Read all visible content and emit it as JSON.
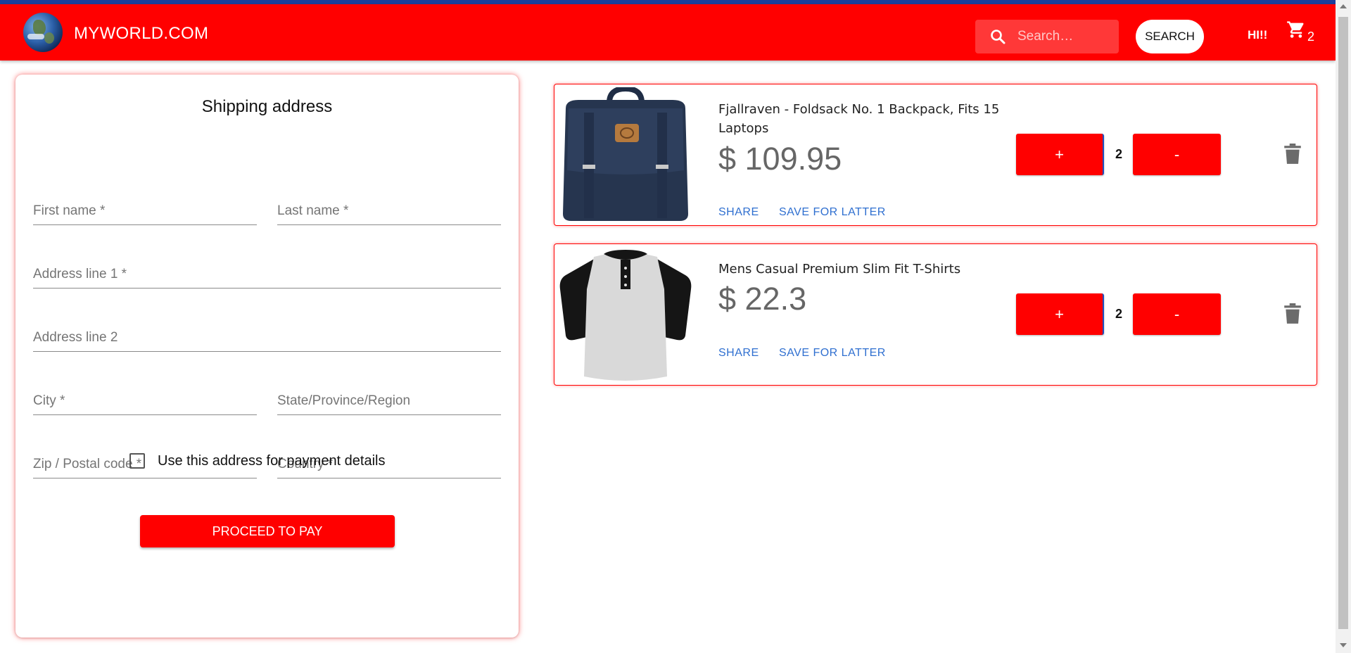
{
  "header": {
    "brand": "MYWORLD.COM",
    "logo_icon": "globe-icon",
    "search_placeholder": "Search…",
    "search_button": "SEARCH",
    "greeting": "HI!!",
    "cart_icon": "cart-icon",
    "cart_count": "2",
    "color": "#ff0000"
  },
  "form": {
    "title": "Shipping address",
    "fields": {
      "first_name": "First name *",
      "last_name": "Last name *",
      "address1": "Address line 1 *",
      "address2": "Address line 2",
      "city": "City *",
      "state": "State/Province/Region",
      "zip": "Zip / Postal code *",
      "country": "Country *"
    },
    "checkbox_label": "Use this address for payment details",
    "checkbox_checked": false,
    "submit": "PROCEED TO PAY"
  },
  "cart": {
    "items": [
      {
        "name": "Fjallraven - Foldsack No. 1 Backpack, Fits 15 Laptops",
        "price": "$ 109.95",
        "quantity": "2",
        "share": "SHARE",
        "save": "SAVE FOR LATTER",
        "plus": "+",
        "minus": "-",
        "image": "backpack-image"
      },
      {
        "name": "Mens Casual Premium Slim Fit T-Shirts",
        "price": "$ 22.3",
        "quantity": "2",
        "share": "SHARE",
        "save": "SAVE FOR LATTER",
        "plus": "+",
        "minus": "-",
        "image": "tshirt-image"
      }
    ]
  },
  "colors": {
    "accent": "#ff0000",
    "link": "#2f6fd0",
    "price": "#666666"
  }
}
